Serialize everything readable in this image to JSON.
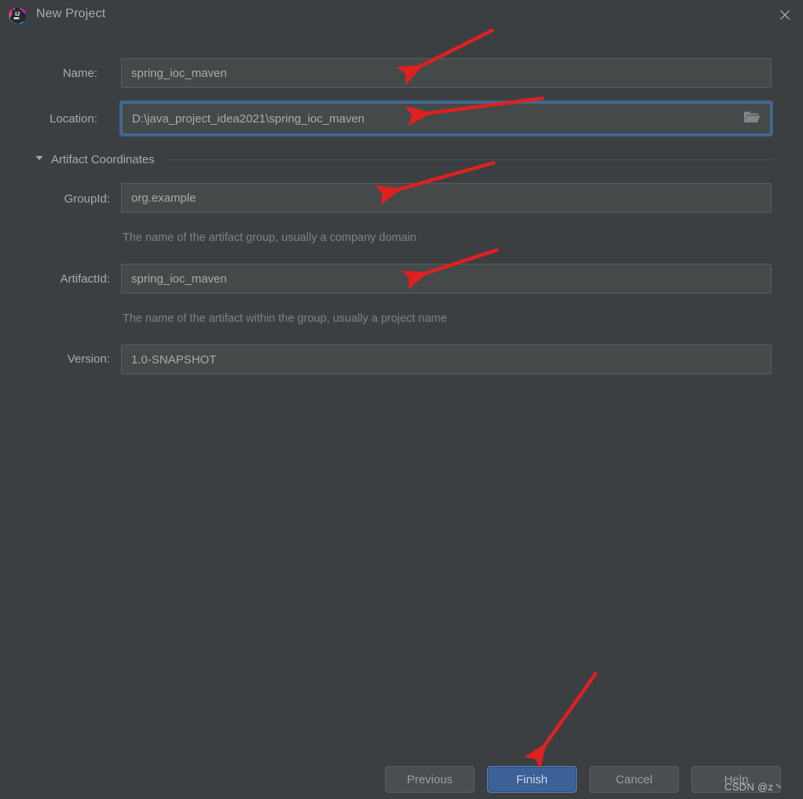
{
  "window": {
    "title": "New Project",
    "app_icon": "intellij-idea-icon",
    "close_icon": "close-icon"
  },
  "form": {
    "name": {
      "label": "Name:",
      "value": "spring_ioc_maven",
      "focused": false
    },
    "location": {
      "label": "Location:",
      "value": "D:\\java_project_idea2021\\spring_ioc_maven",
      "focused": true,
      "browse_icon": "folder-icon"
    },
    "artifact_section": {
      "title": "Artifact Coordinates",
      "expanded": true,
      "toggle_icon": "chevron-down-icon"
    },
    "group_id": {
      "label": "GroupId:",
      "value": "org.example",
      "helper": "The name of the artifact group, usually a company domain"
    },
    "artifact_id": {
      "label": "ArtifactId:",
      "value": "spring_ioc_maven",
      "helper": "The name of the artifact within the group, usually a project name"
    },
    "version": {
      "label": "Version:",
      "value": "1.0-SNAPSHOT"
    }
  },
  "footer": {
    "previous": "Previous",
    "finish": "Finish",
    "cancel": "Cancel",
    "help": "Help"
  },
  "watermark": "CSDN @z丶",
  "colors": {
    "window_bg": "#3c3f41",
    "field_bg": "#45494a",
    "field_border": "#5a5e60",
    "focus_blue": "#466d94",
    "primary_btn": "#3c6098",
    "text": "#a9acae",
    "helper_text": "#7e8284",
    "annotation_red": "#e02020"
  }
}
